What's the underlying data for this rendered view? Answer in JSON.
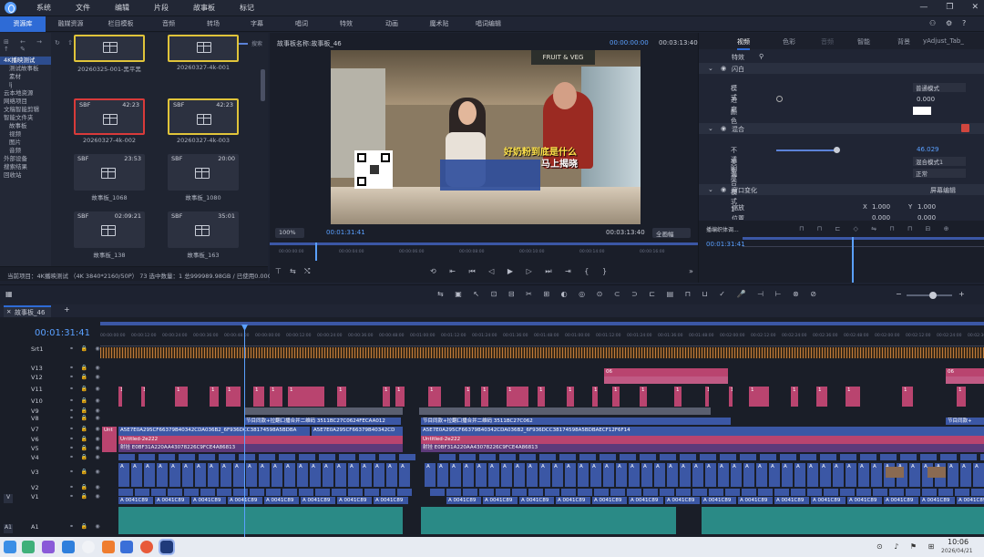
{
  "menu": [
    "系统",
    "文件",
    "编辑",
    "片段",
    "故事板",
    "标记"
  ],
  "tabs": [
    "资源库",
    "融媒资源",
    "栏目模板",
    "音频",
    "转场",
    "字幕",
    "唱词",
    "特效",
    "动画",
    "魔术贴",
    "唱词编辑"
  ],
  "library": {
    "search_placeholder": "搜索",
    "tree": [
      "4K播映测试",
      "测试故事板",
      "素材",
      "lj",
      "云本地资源",
      "网络项目",
      "文稿智能剪辑",
      "智能文件夹",
      "故事板",
      "视频",
      "图片",
      "音频",
      "外部设备",
      "搜索结果",
      "回收站"
    ],
    "thumbs": [
      {
        "name": "20260325-001-黑平黑",
        "type": "",
        "dur": ""
      },
      {
        "name": "20260327-4k-001",
        "type": "",
        "dur": ""
      },
      {
        "name": "20260327-4k-002",
        "type": "SBF",
        "dur": "42:23"
      },
      {
        "name": "20260327-4k-003",
        "type": "SBF",
        "dur": "42:23"
      },
      {
        "name": "故事板_1068",
        "type": "SBF",
        "dur": "23:53"
      },
      {
        "name": "故事板_1080",
        "type": "SBF",
        "dur": "20:00"
      },
      {
        "name": "故事板_138",
        "type": "SBF",
        "dur": "02:09:21"
      },
      {
        "name": "故事板_163",
        "type": "SBF",
        "dur": "35:01"
      }
    ],
    "status": "当前项目：4K播映测试 （4K 3840*2160/50P） 73  选中数量：1  总999989.98GB / 已使用0.00GB"
  },
  "preview": {
    "title": "故事板名称:故事板_46",
    "tc_in": "00:00:00:00",
    "tc_dur": "00:03:13:40",
    "zoom": "100%",
    "current": "00:01:31:41",
    "total": "00:03:13:40",
    "view": "全画幅",
    "caption_yellow": "好奶粉到底是什么",
    "caption_white": "马上揭晓",
    "ruler": [
      "00:00:00:00",
      "00:00:04:00",
      "00:00:06:00",
      "00:00:08:00",
      "00:00:10:00",
      "00:00:14:00",
      "00:00:16:00",
      "00:00:18:00"
    ]
  },
  "props": {
    "tabs": [
      "视频",
      "色彩",
      "音频",
      "智能",
      "背景",
      "yAdjust_Tab_"
    ],
    "special": "特效",
    "sections": {
      "flash": "闪白",
      "mix": "混合",
      "window": "窗口变化"
    },
    "flash_rows": [
      {
        "label": "模式",
        "value": "普通模式"
      },
      {
        "label": "进度",
        "value": "0.000"
      },
      {
        "label": "颜色",
        "value": ""
      }
    ],
    "mix_rows": [
      {
        "label": "不透明度",
        "value": "46.029"
      },
      {
        "label": "类型",
        "value": "混合模式1"
      },
      {
        "label": "混合模式1",
        "value": "正常"
      }
    ],
    "window_mode": "屏幕编辑",
    "scale_label": "缩放",
    "pos_label": "位置",
    "x": "1.000",
    "y": "1.000",
    "x2": "0.000",
    "y2": "0.000",
    "mini_tc": "00:01:31:41",
    "mini_label": "播编织体调..."
  },
  "timeline": {
    "tab": "故事板_46",
    "current": "00:01:31:41",
    "tracks": [
      "Srt1",
      "V13",
      "V12",
      "V11",
      "V10",
      "V9",
      "V8",
      "V7",
      "V6",
      "V5",
      "V4",
      "V3",
      "V2",
      "V1",
      "A1"
    ],
    "clip_texts": {
      "v8a": "节目同款+拉翻口播合并二维码 3511BC27C0624FECAA012",
      "v8b": "节目同款+拉翻口播合并二维码 3511BC27C062",
      "v8c": "节目同款+",
      "v7a": "A5E7E0A295CF66379B40342CDA036B2_6F936DCC38174598A5BDBA",
      "v7b": "A5E7E0A295CF66379B40342CD",
      "v7c": "A5E7E0A295CF66379B40342CDA036B2_6F936DCC38174598A5BDBAECF12F6F14",
      "v6a": "Untitled-2e222",
      "v6b": "Untitled-2e222",
      "v5a": "射挂 E0BF31A220AA43078226C9FCE4A86813",
      "v5b": "射挂 E0BF31A220AA43078226C9FCE4A86813",
      "v12": "06",
      "v12b": "06"
    }
  },
  "clock": {
    "time": "10:06",
    "date": "2026/04/21"
  },
  "colors": {
    "accent": "#2e6bd6",
    "pink": "#b9446f",
    "blue": "#3b57a5",
    "teal": "#2a8a86"
  }
}
